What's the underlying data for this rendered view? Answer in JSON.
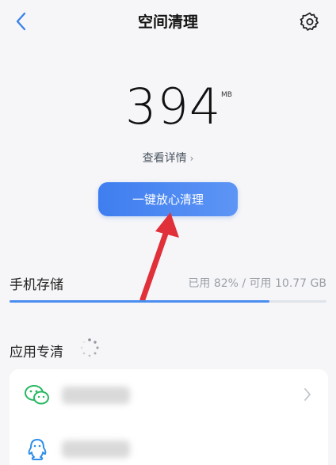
{
  "header": {
    "title": "空间清理"
  },
  "summary": {
    "size_value": "394",
    "size_unit": "MB",
    "details_label": "查看详情",
    "details_chevron": "›"
  },
  "actions": {
    "clean_label": "一键放心清理"
  },
  "storage": {
    "label": "手机存储",
    "info": "已用 82% / 可用 10.77 GB",
    "used_fraction": 0.82
  },
  "apps_section": {
    "title": "应用专清",
    "items": [
      {
        "icon": "wechat-icon"
      },
      {
        "icon": "qq-icon"
      }
    ]
  },
  "colors": {
    "accent": "#4a8df0",
    "annotation_arrow": "#e0303a",
    "background": "#f6f6f8"
  }
}
